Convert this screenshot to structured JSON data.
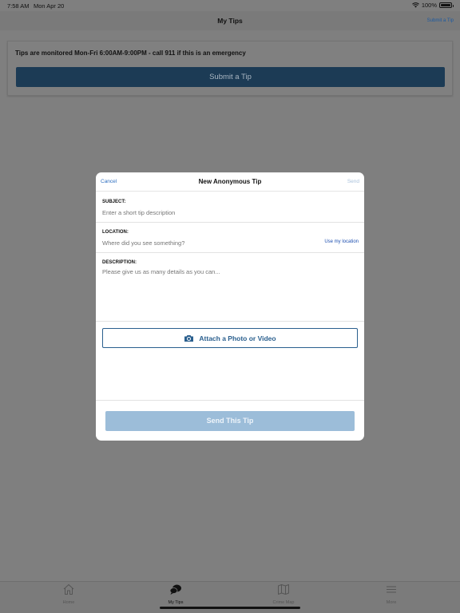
{
  "status_bar": {
    "time": "7:58 AM",
    "date": "Mon Apr 20",
    "battery": "100%",
    "icons": [
      "wifi-icon",
      "battery-icon"
    ]
  },
  "nav": {
    "title": "My Tips",
    "action": "Submit a Tip"
  },
  "info": {
    "notice": "Tips are monitored Mon-Fri 6:00AM-9:00PM - call 911 if this is an emergency",
    "submit_label": "Submit a Tip"
  },
  "modal": {
    "cancel": "Cancel",
    "title": "New Anonymous Tip",
    "send": "Send",
    "subject": {
      "label": "SUBJECT:",
      "placeholder": "Enter a short tip description"
    },
    "location": {
      "label": "LOCATION:",
      "placeholder": "Where did you see something?",
      "use_my_location": "Use my location"
    },
    "description": {
      "label": "DESCRIPTION:",
      "placeholder": "Please give us as many details as you can..."
    },
    "attach_label": "Attach a Photo or Video",
    "send_tip_label": "Send This Tip"
  },
  "tabs": [
    {
      "label": "Home",
      "icon": "home-icon",
      "active": false
    },
    {
      "label": "My Tips",
      "icon": "chat-bubbles-icon",
      "active": true
    },
    {
      "label": "Crime Map",
      "icon": "map-icon",
      "active": false
    },
    {
      "label": "More",
      "icon": "menu-icon",
      "active": false
    }
  ],
  "colors": {
    "accent": "#2a5f8e",
    "link": "#2f6fc0",
    "disabled_button": "#9cbdd9"
  }
}
